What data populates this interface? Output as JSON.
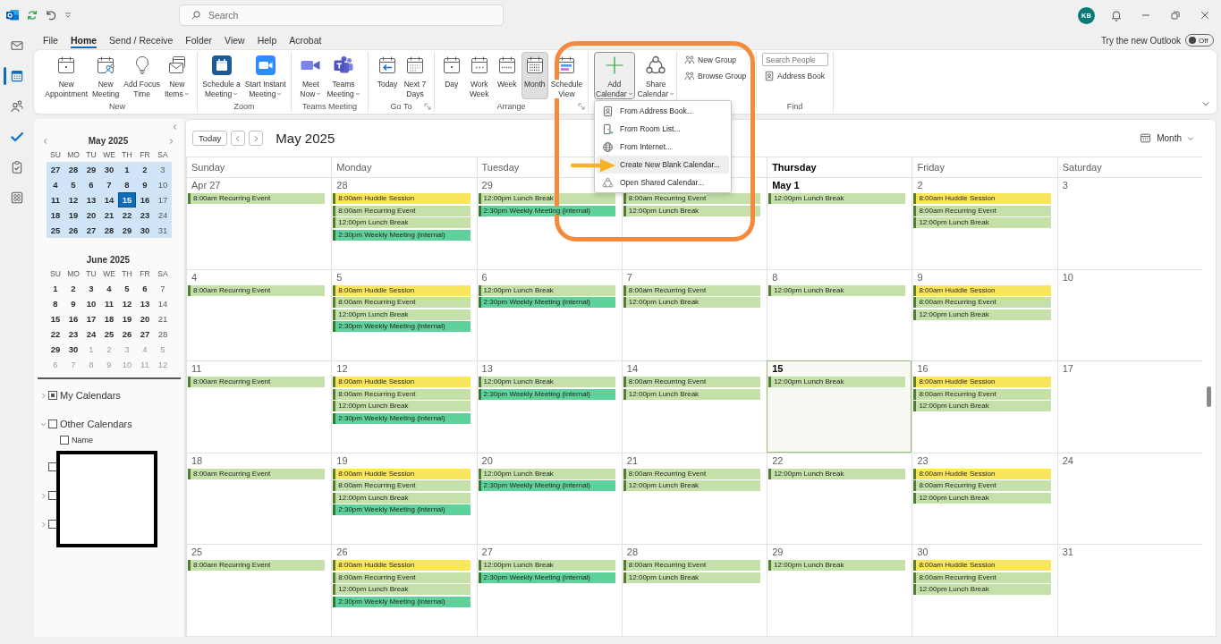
{
  "title_bar": {
    "search": {
      "placeholder": "Search"
    },
    "avatar": {
      "initials": "KB"
    }
  },
  "nav_rail": {
    "items": [
      {
        "selected": false
      },
      {
        "selected": true
      },
      {
        "selected": false
      },
      {
        "selected": false
      },
      {
        "selected": false
      },
      {
        "selected": false
      }
    ]
  },
  "menu_tabs": [
    {
      "label": "File",
      "selected": false
    },
    {
      "label": "Home",
      "selected": true
    },
    {
      "label": "Send / Receive",
      "selected": false
    },
    {
      "label": "Folder",
      "selected": false
    },
    {
      "label": "View",
      "selected": false
    },
    {
      "label": "Help",
      "selected": false
    },
    {
      "label": "Acrobat",
      "selected": false
    }
  ],
  "new_outlook": {
    "label": "Try the new Outlook",
    "toggle": {
      "on": false,
      "label": "Off"
    }
  },
  "ribbon": {
    "groups": [
      {
        "label": "New",
        "items": [
          {
            "kind": "large",
            "label": "New\nAppointment",
            "dropdown": false,
            "selected": false,
            "expanded": false
          },
          {
            "kind": "large",
            "label": "New\nMeeting",
            "dropdown": false,
            "selected": false,
            "expanded": false
          },
          {
            "kind": "large",
            "label": "Add Focus\nTime",
            "dropdown": false,
            "selected": false,
            "expanded": false
          },
          {
            "kind": "large",
            "label": "New\nItems",
            "dropdown": true,
            "selected": false,
            "expanded": false
          }
        ]
      },
      {
        "label": "Zoom",
        "items": [
          {
            "kind": "large",
            "label": "Schedule a\nMeeting",
            "dropdown": true,
            "selected": false,
            "expanded": false
          },
          {
            "kind": "large",
            "label": "Start Instant\nMeeting",
            "dropdown": true,
            "selected": false,
            "expanded": false
          }
        ]
      },
      {
        "label": "Teams Meeting",
        "items": [
          {
            "kind": "large",
            "label": "Meet\nNow",
            "dropdown": true,
            "selected": false,
            "expanded": false
          },
          {
            "kind": "large",
            "label": "Teams\nMeeting",
            "dropdown": true,
            "selected": false,
            "expanded": false
          }
        ]
      },
      {
        "label": "Go To",
        "launcher": true,
        "items": [
          {
            "kind": "large",
            "label": "Today",
            "dropdown": false,
            "selected": false,
            "expanded": false
          },
          {
            "kind": "large",
            "label": "Next 7\nDays",
            "dropdown": false,
            "selected": false,
            "expanded": false
          }
        ]
      },
      {
        "label": "Arrange",
        "launcher": true,
        "items": [
          {
            "kind": "large",
            "label": "Day",
            "dropdown": false,
            "selected": false,
            "expanded": false
          },
          {
            "kind": "large",
            "label": "Work\nWeek",
            "dropdown": false,
            "selected": false,
            "expanded": false
          },
          {
            "kind": "large",
            "label": "Week",
            "dropdown": false,
            "selected": false,
            "expanded": false
          },
          {
            "kind": "large",
            "label": "Month",
            "dropdown": false,
            "selected": true,
            "expanded": false
          },
          {
            "kind": "large",
            "label": "Schedule\nView",
            "dropdown": false,
            "selected": false,
            "expanded": false
          }
        ]
      },
      {
        "items": [
          {
            "kind": "large",
            "label": "Add\nCalendar",
            "dropdown": true,
            "selected": false,
            "expanded": true,
            "menu": {
              "items": [
                {
                  "label": "From Address Book...",
                  "selected": false
                },
                {
                  "label": "From Room List...",
                  "selected": false
                },
                {
                  "label": "From Internet...",
                  "selected": false
                },
                {
                  "label": "Create New Blank Calendar...",
                  "selected": true
                },
                {
                  "label": "Open Shared Calendar...",
                  "selected": false
                }
              ]
            }
          },
          {
            "kind": "large",
            "label": "Share\nCalendar",
            "dropdown": true,
            "selected": false,
            "expanded": false
          }
        ]
      },
      {
        "items": [
          {
            "kind": "small",
            "label": "New Group"
          },
          {
            "kind": "small",
            "label": "Browse Group"
          }
        ]
      },
      {
        "label": "Find",
        "items": [
          {
            "kind": "search",
            "placeholder": "Search People"
          },
          {
            "kind": "small",
            "label": "Address Book"
          }
        ]
      }
    ]
  },
  "date_navigator": {
    "months": [
      {
        "title": "May 2025",
        "nav": true,
        "in_view": true,
        "weekdays": [
          "SU",
          "MO",
          "TU",
          "WE",
          "TH",
          "FR",
          "SA"
        ],
        "weeks": [
          [
            {
              "day": "27",
              "kind": "busy",
              "selected": false
            },
            {
              "day": "28",
              "kind": "busy",
              "selected": false
            },
            {
              "day": "29",
              "kind": "busy",
              "selected": false
            },
            {
              "day": "30",
              "kind": "busy",
              "selected": false
            },
            {
              "day": "1",
              "kind": "busy",
              "selected": false
            },
            {
              "day": "2",
              "kind": "busy",
              "selected": false
            },
            {
              "day": "3",
              "kind": "free",
              "selected": false
            }
          ],
          [
            {
              "day": "4",
              "kind": "busy",
              "selected": false
            },
            {
              "day": "5",
              "kind": "busy",
              "selected": false
            },
            {
              "day": "6",
              "kind": "busy",
              "selected": false
            },
            {
              "day": "7",
              "kind": "busy",
              "selected": false
            },
            {
              "day": "8",
              "kind": "busy",
              "selected": false
            },
            {
              "day": "9",
              "kind": "busy",
              "selected": false
            },
            {
              "day": "10",
              "kind": "free",
              "selected": false
            }
          ],
          [
            {
              "day": "11",
              "kind": "busy",
              "selected": false
            },
            {
              "day": "12",
              "kind": "busy",
              "selected": false
            },
            {
              "day": "13",
              "kind": "busy",
              "selected": false
            },
            {
              "day": "14",
              "kind": "busy",
              "selected": false
            },
            {
              "day": "15",
              "kind": "busy",
              "selected": true
            },
            {
              "day": "16",
              "kind": "busy",
              "selected": false
            },
            {
              "day": "17",
              "kind": "free",
              "selected": false
            }
          ],
          [
            {
              "day": "18",
              "kind": "busy",
              "selected": false
            },
            {
              "day": "19",
              "kind": "busy",
              "selected": false
            },
            {
              "day": "20",
              "kind": "busy",
              "selected": false
            },
            {
              "day": "21",
              "kind": "busy",
              "selected": false
            },
            {
              "day": "22",
              "kind": "busy",
              "selected": false
            },
            {
              "day": "23",
              "kind": "busy",
              "selected": false
            },
            {
              "day": "24",
              "kind": "free",
              "selected": false
            }
          ],
          [
            {
              "day": "25",
              "kind": "busy",
              "selected": false
            },
            {
              "day": "26",
              "kind": "busy",
              "selected": false
            },
            {
              "day": "27",
              "kind": "busy",
              "selected": false
            },
            {
              "day": "28",
              "kind": "busy",
              "selected": false
            },
            {
              "day": "29",
              "kind": "busy",
              "selected": false
            },
            {
              "day": "30",
              "kind": "busy",
              "selected": false
            },
            {
              "day": "31",
              "kind": "free",
              "selected": false
            }
          ]
        ]
      },
      {
        "title": "June 2025",
        "weekdays": [
          "SU",
          "MO",
          "TU",
          "WE",
          "TH",
          "FR",
          "SA"
        ],
        "weeks": [
          [
            {
              "day": "1",
              "kind": "busy",
              "selected": false
            },
            {
              "day": "2",
              "kind": "busy",
              "selected": false
            },
            {
              "day": "3",
              "kind": "busy",
              "selected": false
            },
            {
              "day": "4",
              "kind": "busy",
              "selected": false
            },
            {
              "day": "5",
              "kind": "busy",
              "selected": false
            },
            {
              "day": "6",
              "kind": "busy",
              "selected": false
            },
            {
              "day": "7",
              "kind": "free",
              "selected": false
            }
          ],
          [
            {
              "day": "8",
              "kind": "busy",
              "selected": false
            },
            {
              "day": "9",
              "kind": "busy",
              "selected": false
            },
            {
              "day": "10",
              "kind": "busy",
              "selected": false
            },
            {
              "day": "11",
              "kind": "busy",
              "selected": false
            },
            {
              "day": "12",
              "kind": "busy",
              "selected": false
            },
            {
              "day": "13",
              "kind": "busy",
              "selected": false
            },
            {
              "day": "14",
              "kind": "free",
              "selected": false
            }
          ],
          [
            {
              "day": "15",
              "kind": "busy",
              "selected": false
            },
            {
              "day": "16",
              "kind": "busy",
              "selected": false
            },
            {
              "day": "17",
              "kind": "busy",
              "selected": false
            },
            {
              "day": "18",
              "kind": "busy",
              "selected": false
            },
            {
              "day": "19",
              "kind": "busy",
              "selected": false
            },
            {
              "day": "20",
              "kind": "busy",
              "selected": false
            },
            {
              "day": "21",
              "kind": "free",
              "selected": false
            }
          ],
          [
            {
              "day": "22",
              "kind": "busy",
              "selected": false
            },
            {
              "day": "23",
              "kind": "busy",
              "selected": false
            },
            {
              "day": "24",
              "kind": "busy",
              "selected": false
            },
            {
              "day": "25",
              "kind": "busy",
              "selected": false
            },
            {
              "day": "26",
              "kind": "busy",
              "selected": false
            },
            {
              "day": "27",
              "kind": "busy",
              "selected": false
            },
            {
              "day": "28",
              "kind": "free",
              "selected": false
            }
          ],
          [
            {
              "day": "29",
              "kind": "busy",
              "selected": false
            },
            {
              "day": "30",
              "kind": "busy",
              "selected": false
            },
            {
              "day": "1",
              "kind": "outside",
              "selected": false
            },
            {
              "day": "2",
              "kind": "outside",
              "selected": false
            },
            {
              "day": "3",
              "kind": "outside",
              "selected": false
            },
            {
              "day": "4",
              "kind": "outside",
              "selected": false
            },
            {
              "day": "5",
              "kind": "outside",
              "selected": false
            }
          ],
          [
            {
              "day": "6",
              "kind": "outside",
              "selected": false
            },
            {
              "day": "7",
              "kind": "outside",
              "selected": false
            },
            {
              "day": "8",
              "kind": "outside",
              "selected": false
            },
            {
              "day": "9",
              "kind": "outside",
              "selected": false
            },
            {
              "day": "10",
              "kind": "outside",
              "selected": false
            },
            {
              "day": "11",
              "kind": "outside",
              "selected": false
            },
            {
              "day": "12",
              "kind": "outside",
              "selected": false
            }
          ]
        ]
      }
    ]
  },
  "calendar_folders": [
    {
      "kind": "group",
      "label": "My Calendars",
      "expanded": false,
      "checked": true
    },
    {
      "kind": "group",
      "label": "Other Calendars",
      "expanded": true,
      "checked": false,
      "children": [
        {
          "label": "Name",
          "checked": false
        }
      ]
    },
    {
      "kind": "leaf",
      "checked": false
    },
    {
      "kind": "group",
      "expanded": false,
      "checked": false
    },
    {
      "kind": "group",
      "expanded": false,
      "checked": false
    }
  ],
  "calendar": {
    "today_button": "Today",
    "title": "May 2025",
    "view_switch": "Month",
    "columns": [
      {
        "header": "Sunday",
        "today": false,
        "days": [
          {
            "date": "Apr 27",
            "today": false,
            "month_start": false,
            "events": [
              {
                "title": "8:00am Recurring Event",
                "color": "#c5e0a9"
              }
            ]
          },
          {
            "date": "4",
            "today": false,
            "month_start": false,
            "events": [
              {
                "title": "8:00am Recurring Event",
                "color": "#c5e0a9"
              }
            ]
          },
          {
            "date": "11",
            "today": false,
            "month_start": false,
            "events": [
              {
                "title": "8:00am Recurring Event",
                "color": "#c5e0a9"
              }
            ]
          },
          {
            "date": "18",
            "today": false,
            "month_start": false,
            "events": [
              {
                "title": "8:00am Recurring Event",
                "color": "#c5e0a9"
              }
            ]
          },
          {
            "date": "25",
            "today": false,
            "month_start": false,
            "events": [
              {
                "title": "8:00am Recurring Event",
                "color": "#c5e0a9"
              }
            ]
          }
        ]
      },
      {
        "header": "Monday",
        "today": false,
        "days": [
          {
            "date": "28",
            "today": false,
            "month_start": false,
            "events": [
              {
                "title": "8:00am Huddle Session",
                "color": "#f9e65c"
              },
              {
                "title": "8:00am Recurring Event",
                "color": "#c5e0a9"
              },
              {
                "title": "12:00pm Lunch Break",
                "color": "#c5e0a9"
              },
              {
                "title": "2:30pm Weekly Meeting (internal)",
                "color": "#5fd19b"
              }
            ]
          },
          {
            "date": "5",
            "today": false,
            "month_start": false,
            "events": [
              {
                "title": "8:00am Huddle Session",
                "color": "#f9e65c"
              },
              {
                "title": "8:00am Recurring Event",
                "color": "#c5e0a9"
              },
              {
                "title": "12:00pm Lunch Break",
                "color": "#c5e0a9"
              },
              {
                "title": "2:30pm Weekly Meeting (internal)",
                "color": "#5fd19b"
              }
            ]
          },
          {
            "date": "12",
            "today": false,
            "month_start": false,
            "events": [
              {
                "title": "8:00am Huddle Session",
                "color": "#f9e65c"
              },
              {
                "title": "8:00am Recurring Event",
                "color": "#c5e0a9"
              },
              {
                "title": "12:00pm Lunch Break",
                "color": "#c5e0a9"
              },
              {
                "title": "2:30pm Weekly Meeting (internal)",
                "color": "#5fd19b"
              }
            ]
          },
          {
            "date": "19",
            "today": false,
            "month_start": false,
            "events": [
              {
                "title": "8:00am Huddle Session",
                "color": "#f9e65c"
              },
              {
                "title": "8:00am Recurring Event",
                "color": "#c5e0a9"
              },
              {
                "title": "12:00pm Lunch Break",
                "color": "#c5e0a9"
              },
              {
                "title": "2:30pm Weekly Meeting (internal)",
                "color": "#5fd19b"
              }
            ]
          },
          {
            "date": "26",
            "today": false,
            "month_start": false,
            "events": [
              {
                "title": "8:00am Huddle Session",
                "color": "#f9e65c"
              },
              {
                "title": "8:00am Recurring Event",
                "color": "#c5e0a9"
              },
              {
                "title": "12:00pm Lunch Break",
                "color": "#c5e0a9"
              },
              {
                "title": "2:30pm Weekly Meeting (internal)",
                "color": "#5fd19b"
              }
            ]
          }
        ]
      },
      {
        "header": "Tuesday",
        "today": false,
        "days": [
          {
            "date": "29",
            "today": false,
            "month_start": false,
            "events": [
              {
                "title": "12:00pm Lunch Break",
                "color": "#c5e0a9"
              },
              {
                "title": "2:30pm Weekly Meeting (internal)",
                "color": "#5fd19b"
              }
            ]
          },
          {
            "date": "6",
            "today": false,
            "month_start": false,
            "events": [
              {
                "title": "12:00pm Lunch Break",
                "color": "#c5e0a9"
              },
              {
                "title": "2:30pm Weekly Meeting (internal)",
                "color": "#5fd19b"
              }
            ]
          },
          {
            "date": "13",
            "today": false,
            "month_start": false,
            "events": [
              {
                "title": "12:00pm Lunch Break",
                "color": "#c5e0a9"
              },
              {
                "title": "2:30pm Weekly Meeting (internal)",
                "color": "#5fd19b"
              }
            ]
          },
          {
            "date": "20",
            "today": false,
            "month_start": false,
            "events": [
              {
                "title": "12:00pm Lunch Break",
                "color": "#c5e0a9"
              },
              {
                "title": "2:30pm Weekly Meeting (internal)",
                "color": "#5fd19b"
              }
            ]
          },
          {
            "date": "27",
            "today": false,
            "month_start": false,
            "events": [
              {
                "title": "12:00pm Lunch Break",
                "color": "#c5e0a9"
              },
              {
                "title": "2:30pm Weekly Meeting (internal)",
                "color": "#5fd19b"
              }
            ]
          }
        ]
      },
      {
        "days": [
          {
            "today": false,
            "events": [
              {
                "title": "8:00am Recurring Event",
                "color": "#c5e0a9"
              },
              {
                "title": "12:00pm Lunch Break",
                "color": "#c5e0a9"
              }
            ]
          },
          {
            "date": "7",
            "today": false,
            "month_start": false,
            "events": [
              {
                "title": "8:00am Recurring Event",
                "color": "#c5e0a9"
              },
              {
                "title": "12:00pm Lunch Break",
                "color": "#c5e0a9"
              }
            ]
          },
          {
            "date": "14",
            "today": false,
            "month_start": false,
            "events": [
              {
                "title": "8:00am Recurring Event",
                "color": "#c5e0a9"
              },
              {
                "title": "12:00pm Lunch Break",
                "color": "#c5e0a9"
              }
            ]
          },
          {
            "date": "21",
            "today": false,
            "month_start": false,
            "events": [
              {
                "title": "8:00am Recurring Event",
                "color": "#c5e0a9"
              },
              {
                "title": "12:00pm Lunch Break",
                "color": "#c5e0a9"
              }
            ]
          },
          {
            "date": "28",
            "today": false,
            "month_start": false,
            "events": [
              {
                "title": "8:00am Recurring Event",
                "color": "#c5e0a9"
              },
              {
                "title": "12:00pm Lunch Break",
                "color": "#c5e0a9"
              }
            ]
          }
        ]
      },
      {
        "header": "Thursday",
        "today": true,
        "days": [
          {
            "date": "May 1",
            "today": false,
            "month_start": true,
            "events": [
              {
                "title": "12:00pm Lunch Break",
                "color": "#c5e0a9"
              }
            ]
          },
          {
            "date": "8",
            "today": false,
            "month_start": false,
            "events": [
              {
                "title": "12:00pm Lunch Break",
                "color": "#c5e0a9"
              }
            ]
          },
          {
            "date": "15",
            "today": true,
            "month_start": false,
            "events": [
              {
                "title": "12:00pm Lunch Break",
                "color": "#c5e0a9"
              }
            ]
          },
          {
            "date": "22",
            "today": false,
            "month_start": false,
            "events": [
              {
                "title": "12:00pm Lunch Break",
                "color": "#c5e0a9"
              }
            ]
          },
          {
            "date": "29",
            "today": false,
            "month_start": false,
            "events": [
              {
                "title": "12:00pm Lunch Break",
                "color": "#c5e0a9"
              }
            ]
          }
        ]
      },
      {
        "header": "Friday",
        "today": false,
        "days": [
          {
            "date": "2",
            "today": false,
            "month_start": false,
            "events": [
              {
                "title": "8:00am Huddle Session",
                "color": "#f9e65c"
              },
              {
                "title": "8:00am Recurring Event",
                "color": "#c5e0a9"
              },
              {
                "title": "12:00pm Lunch Break",
                "color": "#c5e0a9"
              }
            ]
          },
          {
            "date": "9",
            "today": false,
            "month_start": false,
            "events": [
              {
                "title": "8:00am Huddle Session",
                "color": "#f9e65c"
              },
              {
                "title": "8:00am Recurring Event",
                "color": "#c5e0a9"
              },
              {
                "title": "12:00pm Lunch Break",
                "color": "#c5e0a9"
              }
            ]
          },
          {
            "date": "16",
            "today": false,
            "month_start": false,
            "events": [
              {
                "title": "8:00am Huddle Session",
                "color": "#f9e65c"
              },
              {
                "title": "8:00am Recurring Event",
                "color": "#c5e0a9"
              },
              {
                "title": "12:00pm Lunch Break",
                "color": "#c5e0a9"
              }
            ]
          },
          {
            "date": "23",
            "today": false,
            "month_start": false,
            "events": [
              {
                "title": "8:00am Huddle Session",
                "color": "#f9e65c"
              },
              {
                "title": "8:00am Recurring Event",
                "color": "#c5e0a9"
              },
              {
                "title": "12:00pm Lunch Break",
                "color": "#c5e0a9"
              }
            ]
          },
          {
            "date": "30",
            "today": false,
            "month_start": false,
            "events": [
              {
                "title": "8:00am Huddle Session",
                "color": "#f9e65c"
              },
              {
                "title": "8:00am Recurring Event",
                "color": "#c5e0a9"
              },
              {
                "title": "12:00pm Lunch Break",
                "color": "#c5e0a9"
              }
            ]
          }
        ]
      },
      {
        "header": "Saturday",
        "today": false,
        "days": [
          {
            "date": "3",
            "today": false,
            "month_start": false
          },
          {
            "date": "10",
            "today": false,
            "month_start": false
          },
          {
            "date": "17",
            "today": false,
            "month_start": false
          },
          {
            "date": "24",
            "today": false,
            "month_start": false
          },
          {
            "date": "31",
            "today": false,
            "month_start": false
          }
        ]
      }
    ]
  }
}
